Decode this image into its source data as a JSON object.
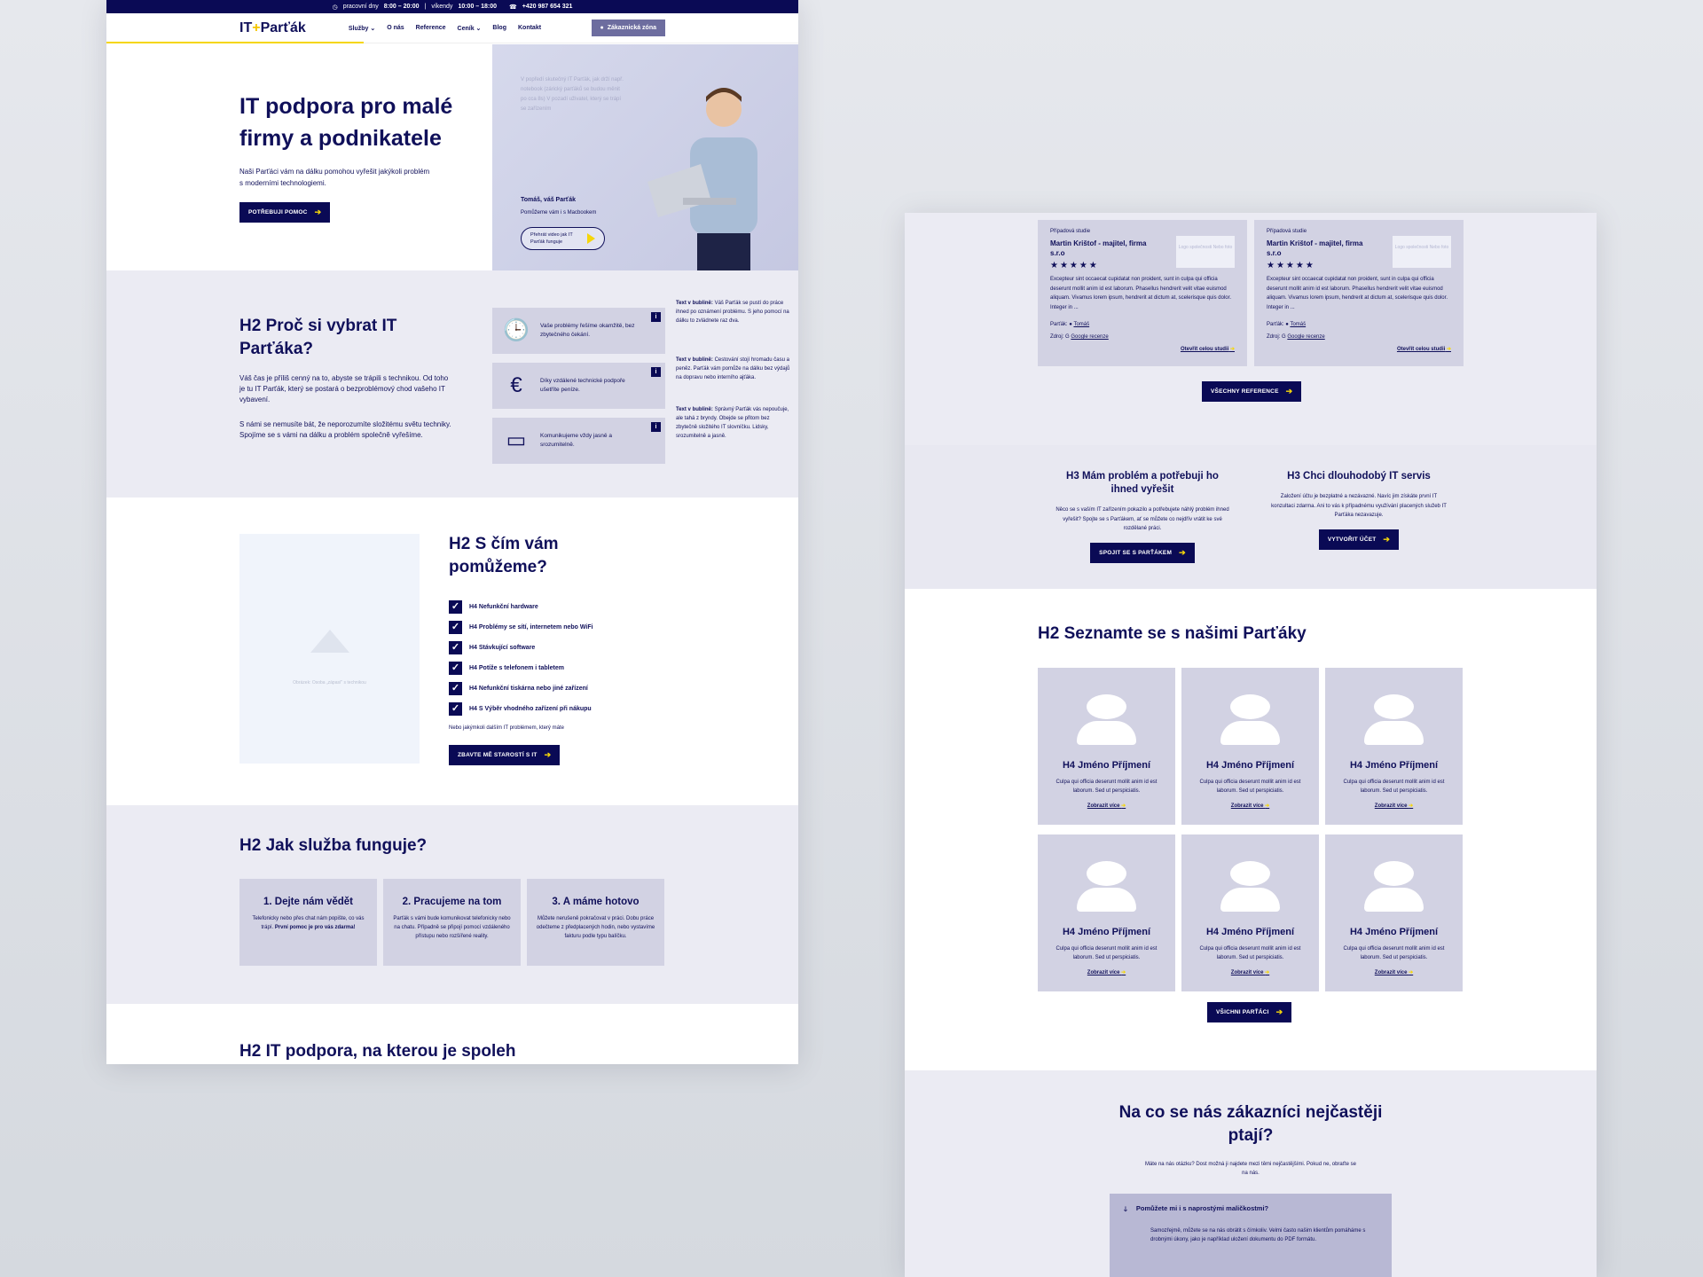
{
  "topbar": {
    "weekdays": "pracovní dny",
    "weekday_hours": "8:00 – 20:00",
    "sep": "|",
    "weekends": "víkendy",
    "weekend_hours": "10:00 – 18:00",
    "phone": "+420 987 654 321"
  },
  "nav": {
    "logo_a": "IT",
    "logo_sep": "+",
    "logo_b": "Parťák",
    "items": [
      "Služby",
      "O nás",
      "Reference",
      "Ceník",
      "Blog",
      "Kontakt"
    ],
    "zone": "Zákaznická zóna"
  },
  "hero": {
    "title": "IT podpora pro malé firmy a podnikatele",
    "text": "Naši Parťáci vám na dálku pomohou vyřešit jakýkoli problém s moderními technologiemi.",
    "cta": "POTŘEBUJI POMOC",
    "note": "V popředí skutečný IT Parťák, jak drží např. notebook (zárický parťáků se budou měnit po cca 8s) V pozadí uživatel, který se trápí se zařízením",
    "name": "Tomáš, váš Parťák",
    "sub": "Pomůžeme vám i s Macbookem",
    "video": "Přehrát video jak IT Parťák funguje"
  },
  "why": {
    "title": "H2 Proč si vybrat IT Parťáka?",
    "p1": "Váš čas je příliš cenný na to, abyste se trápili s technikou. Od toho je tu IT Parťák, který se postará o bezproblémový chod vašeho IT vybavení.",
    "p2": "S námi se nemusíte bát, že neporozumíte složitému světu techniky. Spojíme se s vámi na dálku a problém společně vyřešíme.",
    "cards": [
      {
        "icon": "clock-icon",
        "glyph": "🕒",
        "text": "Vaše problémy řešíme okamžitě, bez zbytečného čekání."
      },
      {
        "icon": "euro-icon",
        "glyph": "€",
        "text": "Díky vzdálené technické podpoře ušetříte peníze."
      },
      {
        "icon": "devices-icon",
        "glyph": "▭",
        "text": "Komunikujeme vždy jasně a srozumitelně."
      }
    ],
    "info": "i",
    "bubble_label": "Text v bublině:",
    "bubbles": [
      "Váš Parťák se pustí do práce ihned po oznámení problému. S jeho pomocí na dálku to zvládnete raz dva.",
      "Cestování stojí hromadu času a peněz. Parťák vám pomůže na dálku bez výdajů na dopravu nebo interního ajťáka.",
      "Správný Parťák vás nepoučuje, ale tahá z bryndy. Obejde se přitom bez zbytečně složitého IT slovníčku. Lidsky, srozumitelně a jasně."
    ]
  },
  "help": {
    "title": "H2 S čím vám pomůžeme?",
    "img_caption": "Obrázek: Osoba „zápasí\" s technikou",
    "items": [
      "H4 Nefunkční hardware",
      "H4 Problémy se sítí, internetem nebo WiFi",
      "H4 Stávkující software",
      "H4 Potíže s telefonem i tabletem",
      "H4 Nefunkční tiskárna nebo jiné zařízení",
      "H4 S Výběr vhodného zařízení při nákupu"
    ],
    "more": "Nebo jakýmkoli dalším IT problémem, který máte",
    "cta": "ZBAVTE MĚ STAROSTÍ S IT"
  },
  "how": {
    "title": "H2 Jak služba funguje?",
    "steps": [
      {
        "title": "1. Dejte nám vědět",
        "text": "Telefonicky nebo přes chat nám popište, co vás trápí.",
        "bold": "První pomoc je pro vás zdarma!"
      },
      {
        "title": "2. Pracujeme na tom",
        "text": "Parťák s vámi bude komunikovat telefonicky nebo na chatu. Případně se připojí pomocí vzdáleného přístupu nebo rozšířené reality.",
        "bold": ""
      },
      {
        "title": "3. A máme hotovo",
        "text": "Můžete nerušeně pokračovat v práci. Dobu práce odečteme z předplacených hodin, nebo vystavíme fakturu podle typu balíčku.",
        "bold": ""
      }
    ]
  },
  "reliable": {
    "title": "H2 IT podpora, na kterou je spoleh"
  },
  "refs": {
    "cards": [
      {
        "type": "Případová studie",
        "name": "Martin Krištof - majitel, firma s.r.o",
        "stars": "★★★★★",
        "logo": "Logo společnosti Nebo foto",
        "text": "Excepteur sint occaecat cupidatat non proident, sunt in culpa qui officia deserunt mollit anim id est laborum. Phasellus hendrerit velit vitae euismod aliquam. Vivamus lorem ipsum, hendrerit at dictum at, scelerisque quis dolor. Integer in ...",
        "partner_label": "Parťák:",
        "partner": "Tomáš",
        "source_label": "Zdroj:",
        "source": "Google recenze",
        "open": "Otevřít celou studii"
      },
      {
        "type": "Případová studie",
        "name": "Martin Krištof - majitel, firma s.r.o",
        "stars": "★★★★★",
        "logo": "Logo společnosti Nebo foto",
        "text": "Excepteur sint occaecat cupidatat non proident, sunt in culpa qui officia deserunt mollit anim id est laborum. Phasellus hendrerit velit vitae euismod aliquam. Vivamus lorem ipsum, hendrerit at dictum at, scelerisque quis dolor. Integer in ...",
        "partner_label": "Parťák:",
        "partner": "Tomáš",
        "source_label": "Zdroj:",
        "source": "Google recenze",
        "open": "Otevřít celou studii"
      }
    ],
    "cta": "VŠECHNY REFERENCE"
  },
  "paths": [
    {
      "title": "H3 Mám problém a potřebuji ho ihned vyřešit",
      "text": "Něco se s vaším IT zařízením pokazilo a potřebujete náhlý problém ihned vyřešit? Spojte se s Parťákem, ať se můžete co nejdřív vrátit ke své rozdělané práci.",
      "cta": "SPOJIT SE S PARŤÁKEM"
    },
    {
      "title": "H3 Chci dlouhodobý IT servis",
      "text": "Založení účtu je bezplatné a nezávazné. Navíc jim získáte první IT konzultaci zdarma. Ani to vás k případnému využívání placených služeb IT Parťáka nezavazuje.",
      "cta": "VYTVOŘIT ÚČET"
    }
  ],
  "team": {
    "title": "H2 Seznamte se s našimi Parťáky",
    "members": [
      {
        "name": "H4 Jméno Příjmení",
        "text": "Culpa qui officia deserunt mollit anim id est laborum. Sed ut perspiciatis.",
        "link": "Zobrazit více"
      },
      {
        "name": "H4 Jméno Příjmení",
        "text": "Culpa qui officia deserunt mollit anim id est laborum. Sed ut perspiciatis.",
        "link": "Zobrazit více"
      },
      {
        "name": "H4 Jméno Příjmení",
        "text": "Culpa qui officia deserunt mollit anim id est laborum. Sed ut perspiciatis.",
        "link": "Zobrazit více"
      },
      {
        "name": "H4 Jméno Příjmení",
        "text": "Culpa qui officia deserunt mollit anim id est laborum. Sed ut perspiciatis.",
        "link": "Zobrazit více"
      },
      {
        "name": "H4 Jméno Příjmení",
        "text": "Culpa qui officia deserunt mollit anim id est laborum. Sed ut perspiciatis.",
        "link": "Zobrazit více"
      },
      {
        "name": "H4 Jméno Příjmení",
        "text": "Culpa qui officia deserunt mollit anim id est laborum. Sed ut perspiciatis.",
        "link": "Zobrazit více"
      }
    ],
    "cta": "VŠICHNI PARŤÁCI"
  },
  "faq": {
    "title": "Na co se nás zákazníci nejčastěji ptají?",
    "intro": "Máte na nás otázku? Dost možná ji najdete mezi těmi nejčastějšími. Pokud ne, obraťte se na nás.",
    "q": "Pomůžete mi i s naprostými maličkostmi?",
    "a": "Samozřejmě, můžete se na nás obrátit s čímkoliv. Velmi často našim klientům pomáháme s drobnými úkony, jako je například uložení dokumentu do PDF formátu."
  },
  "colors": {
    "navy": "#0a0a55",
    "accent": "#f5d60a",
    "card": "#d2d2e3",
    "section": "#ebebf3"
  }
}
